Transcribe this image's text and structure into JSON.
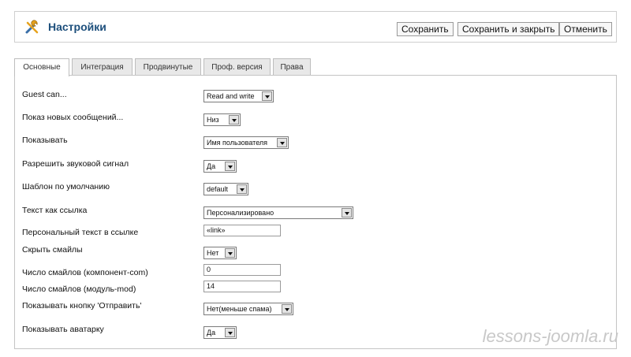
{
  "header": {
    "title": "Настройки",
    "icon": "tools-icon",
    "buttons": {
      "save": "Сохранить",
      "save_close": "Сохранить и закрыть",
      "cancel": "Отменить"
    }
  },
  "tabs": [
    "Основные",
    "Интеграция",
    "Продвинутые",
    "Проф. версия",
    "Права"
  ],
  "active_tab": "Основные",
  "fields": {
    "guest_can": {
      "label": "Guest can...",
      "value": "Read and write"
    },
    "new_messages": {
      "label": "Показ новых сообщений...",
      "value": "Низ"
    },
    "show": {
      "label": "Показывать",
      "value": "Имя пользователя"
    },
    "sound": {
      "label": "Разрешить звуковой сигнал",
      "value": "Да"
    },
    "template": {
      "label": "Шаблон по умолчанию",
      "value": "default"
    },
    "link_text": {
      "label": "Текст как ссылка",
      "value": "Персонализировано"
    },
    "personal_text": {
      "label": "Персональный текст в ссылке",
      "value": "«link»"
    },
    "hide_smiles": {
      "label": "Скрыть смайлы",
      "value": "Нет"
    },
    "smiles_com": {
      "label": "Число смайлов (компонент-com)",
      "value": "0"
    },
    "smiles_mod": {
      "label": "Число смайлов (модуль-mod)",
      "value": "14"
    },
    "send_button": {
      "label": "Показывать кнопку 'Отправить'",
      "value": "Нет(меньше спама)"
    },
    "avatar": {
      "label": "Показывать аватарку",
      "value": "Да"
    }
  },
  "watermark": "lessons-joomla.ru",
  "colors": {
    "title": "#1d4f7c",
    "border": "#c4c4c4",
    "tab_inactive": "#e8e8e8"
  }
}
